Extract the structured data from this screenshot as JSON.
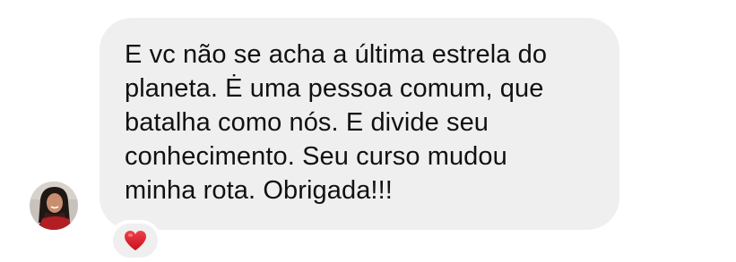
{
  "message": {
    "text": "E vc não se acha a última estrela do\nplaneta.  Ė uma pessoa comum, que\nbatalha como nós. E divide seu\nconhecimento. Seu curso mudou\nminha rota. Obrigada!!!",
    "bubble_color": "#efefef",
    "text_color": "#111111"
  },
  "reaction": {
    "icon": "red-heart-icon",
    "color": "#e11d2a"
  },
  "sender": {
    "avatar_icon": "avatar"
  }
}
